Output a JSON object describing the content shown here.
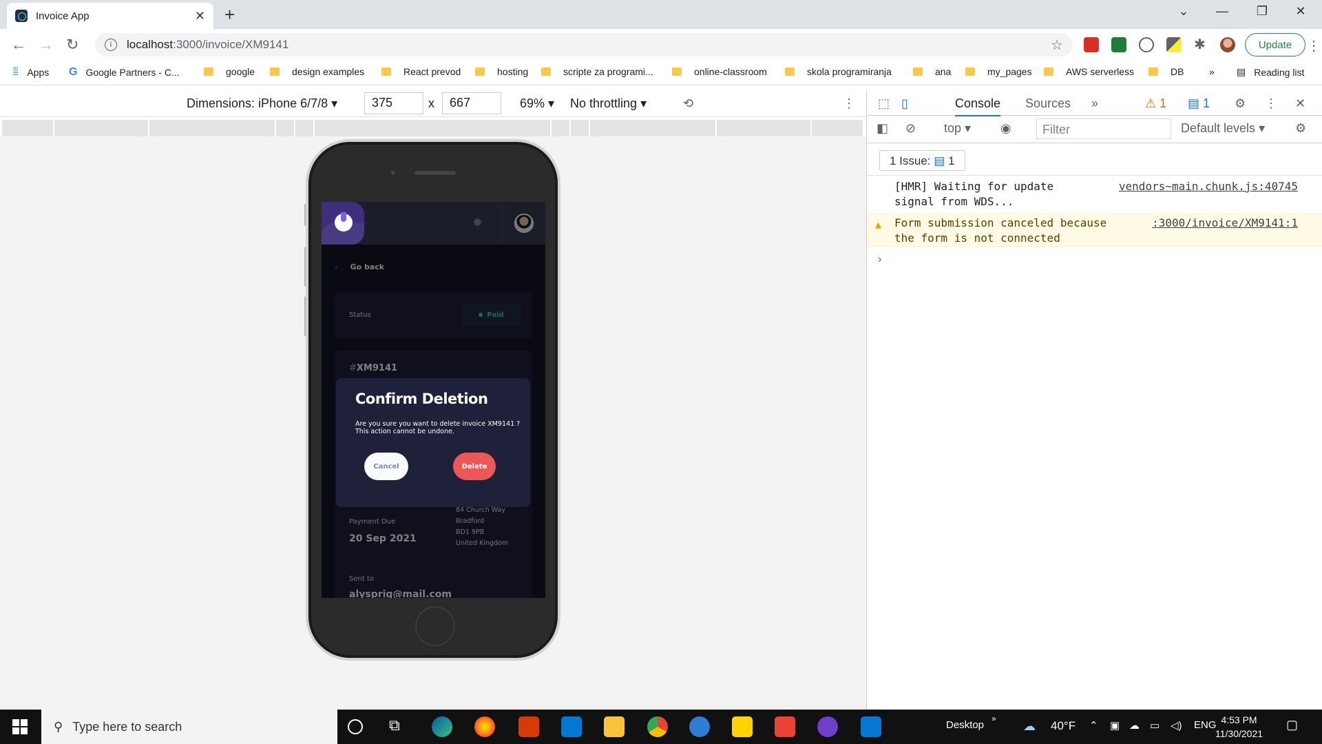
{
  "browser": {
    "tab_title": "Invoice App",
    "url_host": "localhost",
    "url_path": ":3000/invoice/XM9141",
    "update_label": "Update",
    "bookmarks": [
      {
        "label": "Apps",
        "icon": "apps-grid-icon"
      },
      {
        "label": "Google Partners - C...",
        "icon": "google-icon"
      },
      {
        "label": "google",
        "icon": "folder-icon"
      },
      {
        "label": "design examples",
        "icon": "folder-icon"
      },
      {
        "label": "React prevod",
        "icon": "folder-icon"
      },
      {
        "label": "hosting",
        "icon": "folder-icon"
      },
      {
        "label": "scripte za programi...",
        "icon": "folder-icon"
      },
      {
        "label": "online-classroom",
        "icon": "folder-icon"
      },
      {
        "label": "skola programiranja",
        "icon": "folder-icon"
      },
      {
        "label": "ana",
        "icon": "folder-icon"
      },
      {
        "label": "my_pages",
        "icon": "folder-icon"
      },
      {
        "label": "AWS serverless",
        "icon": "folder-icon"
      },
      {
        "label": "DB",
        "icon": "folder-icon"
      }
    ],
    "reading_list": "Reading list",
    "more_bookmarks": "»"
  },
  "device_toolbar": {
    "dimensions": "Dimensions: iPhone 6/7/8",
    "width": "375",
    "times": "x",
    "height": "667",
    "zoom": "69%",
    "throttling": "No throttling"
  },
  "app": {
    "go_back": "Go back",
    "status_label": "Status",
    "status_value": "Paid",
    "invoice_hash": "#",
    "invoice_id": "XM9141",
    "payment_due_label": "Payment Due",
    "payment_due_value": "20 Sep 2021",
    "client_address": [
      "84 Church Way",
      "Bradford",
      "BD1 9PB",
      "United Kingdom"
    ],
    "sent_to_label": "Sent to",
    "sent_to_value": "alysprig@mail.com",
    "modal": {
      "title": "Confirm Deletion",
      "message": "Are you sure you want to delete invoice XM9141 ? This action cannot be undone.",
      "cancel": "Cancel",
      "delete": "Delete"
    }
  },
  "devtools": {
    "tabs": [
      "Console",
      "Sources"
    ],
    "more_tabs": "»",
    "warnings_count": "1",
    "messages_count": "1",
    "context": "top",
    "filter_placeholder": "Filter",
    "levels": "Default levels",
    "issues_label": "1 Issue:",
    "issues_count": "1",
    "logs": [
      {
        "type": "info",
        "text_line1": "[HMR] Waiting for update",
        "text_line2": "signal from WDS...",
        "source": "vendors~main.chunk.js:40745"
      },
      {
        "type": "warning",
        "text_line1": "Form submission canceled because",
        "text_line2": "the form is not connected",
        "source": ":3000/invoice/XM9141:1"
      }
    ]
  },
  "taskbar": {
    "search_placeholder": "Type here to search",
    "desktop_label": "Desktop",
    "temperature": "40°F",
    "language": "ENG",
    "time": "4:53 PM",
    "date": "11/30/2021"
  },
  "colors": {
    "app_bg": "#141625",
    "card_bg": "#1e2139",
    "header_bg": "#373b53",
    "accent": "#7c5dfa",
    "paid_green": "#33d69f",
    "danger": "#ec5757"
  }
}
